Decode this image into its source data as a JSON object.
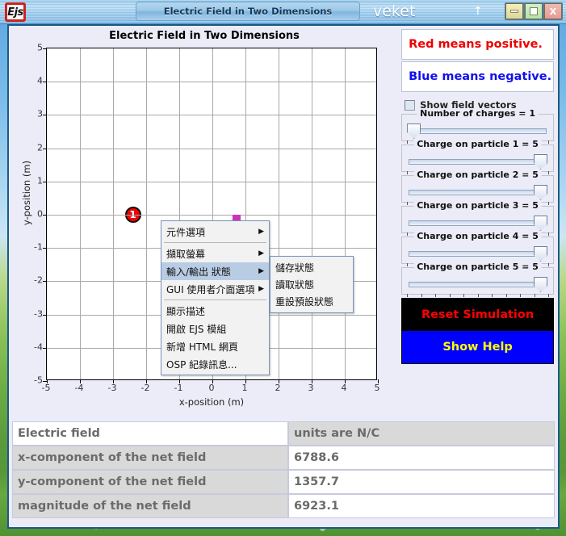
{
  "desktop": {
    "taskbar_label": "veket"
  },
  "titlebar": {
    "logo_text": "Ejs",
    "window_title": "Electric Field in Two Dimensions",
    "minimize_label": "",
    "maximize_label": "",
    "close_label": "X",
    "up_arrow": "↑"
  },
  "plot": {
    "title": "Electric Field in Two Dimensions",
    "xaxis_title": "x-position (m)",
    "yaxis_title": "y-position (m)",
    "x_ticks": [
      "-5",
      "-4",
      "-3",
      "-2",
      "-1",
      "0",
      "1",
      "2",
      "3",
      "4",
      "5"
    ],
    "y_ticks": [
      "5",
      "4",
      "3",
      "2",
      "1",
      "0",
      "-1",
      "-2",
      "-3",
      "-4",
      "-5"
    ],
    "charge_label": "1"
  },
  "chart_data": {
    "type": "scatter",
    "title": "Electric Field in Two Dimensions",
    "xlabel": "x-position (m)",
    "ylabel": "y-position (m)",
    "xlim": [
      -5,
      5
    ],
    "ylim": [
      -5,
      5
    ],
    "grid": true,
    "legend": "none",
    "series": [
      {
        "name": "charge 1",
        "marker": "filled-circle",
        "color": "#ee0000",
        "label": "1",
        "points": [
          {
            "x": -2.4,
            "y": 0.0
          }
        ]
      }
    ],
    "annotations": [
      {
        "text": "Red means positive.",
        "color": "#ee0000"
      },
      {
        "text": "Blue means negative.",
        "color": "#1010ee"
      }
    ]
  },
  "context_menu": {
    "items": [
      {
        "label": "元件選項",
        "submenu": true,
        "selected": false
      },
      {
        "separator": true
      },
      {
        "label": "擷取螢幕",
        "submenu": true,
        "selected": false
      },
      {
        "label": "輸入/輸出 狀態",
        "submenu": true,
        "selected": true
      },
      {
        "label": "GUI 使用者介面選項",
        "submenu": true,
        "selected": false
      },
      {
        "separator": true
      },
      {
        "label": "顯示描述",
        "submenu": false,
        "selected": false
      },
      {
        "label": "開啟 EJS 模組",
        "submenu": false,
        "selected": false
      },
      {
        "label": "新增 HTML 網頁",
        "submenu": false,
        "selected": false
      },
      {
        "label": "OSP 紀錄訊息...",
        "submenu": false,
        "selected": false
      }
    ],
    "submenu_items": [
      {
        "label": "儲存狀態"
      },
      {
        "label": "讀取狀態"
      },
      {
        "label": "重設預設狀態"
      }
    ],
    "arrow_glyph": "▶"
  },
  "controls": {
    "legend_positive": "Red means positive.",
    "legend_negative": "Blue means negative.",
    "checkbox_label": "Show field vectors",
    "checkbox_checked": false,
    "sliders": [
      {
        "label": "Number of charges = 1",
        "value": 1,
        "percent": 0,
        "ticks": 5
      },
      {
        "label": "Charge on particle 1 = 5",
        "value": 5,
        "percent": 100,
        "ticks": 11
      },
      {
        "label": "Charge on particle 2 = 5",
        "value": 5,
        "percent": 100,
        "ticks": 11
      },
      {
        "label": "Charge on particle 3 = 5",
        "value": 5,
        "percent": 100,
        "ticks": 11
      },
      {
        "label": "Charge on particle 4 = 5",
        "value": 5,
        "percent": 100,
        "ticks": 11
      },
      {
        "label": "Charge on particle 5 = 5",
        "value": 5,
        "percent": 100,
        "ticks": 11
      }
    ],
    "reset_button": "Reset Simulation",
    "help_button": "Show Help"
  },
  "table": {
    "rows": [
      {
        "label": "Electric field",
        "value": "units are N/C",
        "header": true
      },
      {
        "label": "x-component of the net field",
        "value": "6788.6",
        "header": false
      },
      {
        "label": "y-component of the net field",
        "value": "1357.7",
        "header": false
      },
      {
        "label": "magnitude of the net field",
        "value": "6923.1",
        "header": false
      }
    ]
  },
  "colors": {
    "positive": "#ee0000",
    "negative": "#1010ee",
    "reset_bg": "#000000",
    "reset_fg": "#ff0000",
    "help_bg": "#0000ff",
    "help_fg": "#ffff00"
  }
}
